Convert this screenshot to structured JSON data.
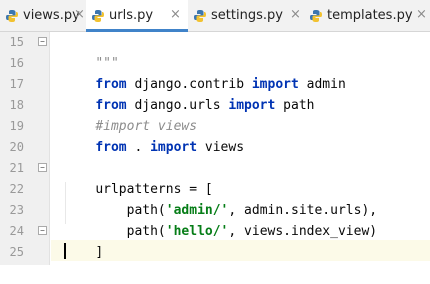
{
  "tabs": [
    {
      "label": "views.py",
      "active": false
    },
    {
      "label": "urls.py",
      "active": true
    },
    {
      "label": "settings.py",
      "active": false
    },
    {
      "label": "templates.py",
      "active": false
    }
  ],
  "close_glyph": "×",
  "line_numbers": [
    "15",
    "16",
    "17",
    "18",
    "19",
    "20",
    "21",
    "22",
    "23",
    "24",
    "25"
  ],
  "code": {
    "l15": "\"\"\"",
    "l16_kw1": "from",
    "l16_mod": " django.contrib ",
    "l16_kw2": "import",
    "l16_name": " admin",
    "l17_kw1": "from",
    "l17_mod": " django.urls ",
    "l17_kw2": "import",
    "l17_name": " path",
    "l18": "#import views",
    "l19_kw1": "from",
    "l19_mod": " . ",
    "l19_kw2": "import",
    "l19_name": " views",
    "l21": "urlpatterns = [",
    "l22_a": "    path(",
    "l22_str": "'admin/'",
    "l22_b": ", admin.site.urls),",
    "l23_a": "    path(",
    "l23_str": "'hello/'",
    "l23_b": ", views.index_view)",
    "l24": "]"
  },
  "colors": {
    "keyword": "#0033b3",
    "string": "#067d17",
    "comment": "#8c8c8c",
    "active_tab_underline": "#4083c9",
    "current_line": "#fcfae8"
  },
  "icons": {
    "file_type": "python-file-icon",
    "close": "close-icon",
    "fold": "fold-marker-icon"
  }
}
